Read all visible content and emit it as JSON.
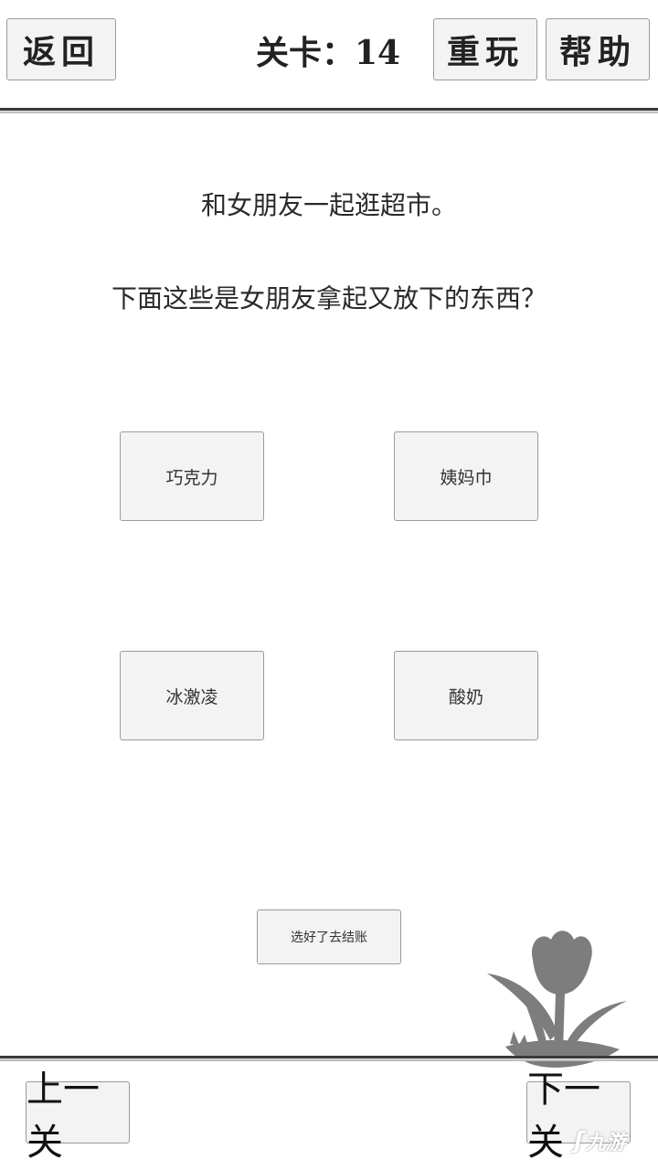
{
  "header": {
    "back_label": "返回",
    "level_label": "关卡：14",
    "replay_label": "重玩",
    "help_label": "帮助"
  },
  "question": {
    "line1": "和女朋友一起逛超市。",
    "line2": "下面这些是女朋友拿起又放下的东西？"
  },
  "options": [
    {
      "label": "巧克力"
    },
    {
      "label": "姨妈巾"
    },
    {
      "label": "冰激凌"
    },
    {
      "label": "酸奶"
    }
  ],
  "checkout_label": "选好了去结账",
  "footer": {
    "prev_label": "上一关",
    "next_label": "下一关"
  },
  "watermark": {
    "icon": "tulip-silhouette-icon",
    "text": "九游"
  }
}
